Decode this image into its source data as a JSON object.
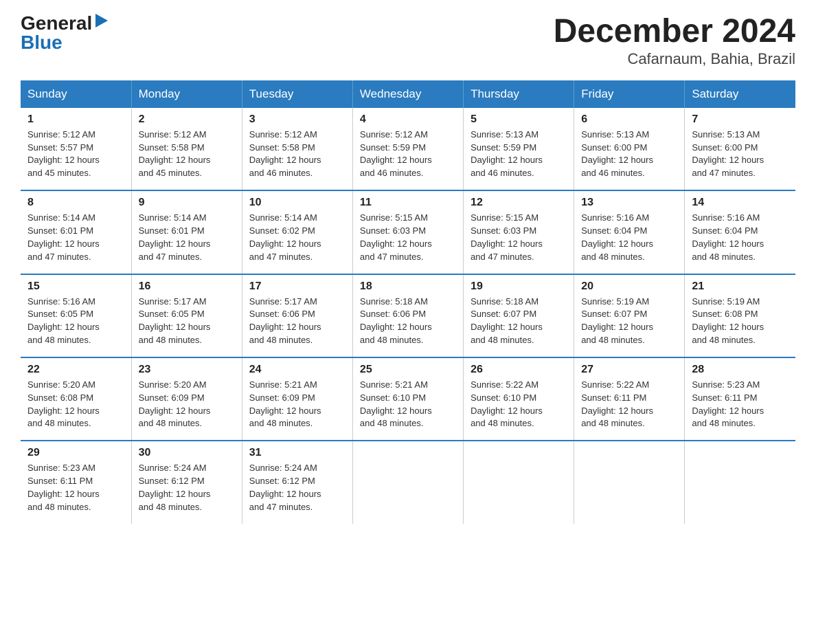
{
  "logo": {
    "general": "General",
    "blue": "Blue"
  },
  "title": "December 2024",
  "subtitle": "Cafarnaum, Bahia, Brazil",
  "days_of_week": [
    "Sunday",
    "Monday",
    "Tuesday",
    "Wednesday",
    "Thursday",
    "Friday",
    "Saturday"
  ],
  "weeks": [
    [
      {
        "day": "1",
        "sunrise": "5:12 AM",
        "sunset": "5:57 PM",
        "daylight": "12 hours and 45 minutes."
      },
      {
        "day": "2",
        "sunrise": "5:12 AM",
        "sunset": "5:58 PM",
        "daylight": "12 hours and 45 minutes."
      },
      {
        "day": "3",
        "sunrise": "5:12 AM",
        "sunset": "5:58 PM",
        "daylight": "12 hours and 46 minutes."
      },
      {
        "day": "4",
        "sunrise": "5:12 AM",
        "sunset": "5:59 PM",
        "daylight": "12 hours and 46 minutes."
      },
      {
        "day": "5",
        "sunrise": "5:13 AM",
        "sunset": "5:59 PM",
        "daylight": "12 hours and 46 minutes."
      },
      {
        "day": "6",
        "sunrise": "5:13 AM",
        "sunset": "6:00 PM",
        "daylight": "12 hours and 46 minutes."
      },
      {
        "day": "7",
        "sunrise": "5:13 AM",
        "sunset": "6:00 PM",
        "daylight": "12 hours and 47 minutes."
      }
    ],
    [
      {
        "day": "8",
        "sunrise": "5:14 AM",
        "sunset": "6:01 PM",
        "daylight": "12 hours and 47 minutes."
      },
      {
        "day": "9",
        "sunrise": "5:14 AM",
        "sunset": "6:01 PM",
        "daylight": "12 hours and 47 minutes."
      },
      {
        "day": "10",
        "sunrise": "5:14 AM",
        "sunset": "6:02 PM",
        "daylight": "12 hours and 47 minutes."
      },
      {
        "day": "11",
        "sunrise": "5:15 AM",
        "sunset": "6:03 PM",
        "daylight": "12 hours and 47 minutes."
      },
      {
        "day": "12",
        "sunrise": "5:15 AM",
        "sunset": "6:03 PM",
        "daylight": "12 hours and 47 minutes."
      },
      {
        "day": "13",
        "sunrise": "5:16 AM",
        "sunset": "6:04 PM",
        "daylight": "12 hours and 48 minutes."
      },
      {
        "day": "14",
        "sunrise": "5:16 AM",
        "sunset": "6:04 PM",
        "daylight": "12 hours and 48 minutes."
      }
    ],
    [
      {
        "day": "15",
        "sunrise": "5:16 AM",
        "sunset": "6:05 PM",
        "daylight": "12 hours and 48 minutes."
      },
      {
        "day": "16",
        "sunrise": "5:17 AM",
        "sunset": "6:05 PM",
        "daylight": "12 hours and 48 minutes."
      },
      {
        "day": "17",
        "sunrise": "5:17 AM",
        "sunset": "6:06 PM",
        "daylight": "12 hours and 48 minutes."
      },
      {
        "day": "18",
        "sunrise": "5:18 AM",
        "sunset": "6:06 PM",
        "daylight": "12 hours and 48 minutes."
      },
      {
        "day": "19",
        "sunrise": "5:18 AM",
        "sunset": "6:07 PM",
        "daylight": "12 hours and 48 minutes."
      },
      {
        "day": "20",
        "sunrise": "5:19 AM",
        "sunset": "6:07 PM",
        "daylight": "12 hours and 48 minutes."
      },
      {
        "day": "21",
        "sunrise": "5:19 AM",
        "sunset": "6:08 PM",
        "daylight": "12 hours and 48 minutes."
      }
    ],
    [
      {
        "day": "22",
        "sunrise": "5:20 AM",
        "sunset": "6:08 PM",
        "daylight": "12 hours and 48 minutes."
      },
      {
        "day": "23",
        "sunrise": "5:20 AM",
        "sunset": "6:09 PM",
        "daylight": "12 hours and 48 minutes."
      },
      {
        "day": "24",
        "sunrise": "5:21 AM",
        "sunset": "6:09 PM",
        "daylight": "12 hours and 48 minutes."
      },
      {
        "day": "25",
        "sunrise": "5:21 AM",
        "sunset": "6:10 PM",
        "daylight": "12 hours and 48 minutes."
      },
      {
        "day": "26",
        "sunrise": "5:22 AM",
        "sunset": "6:10 PM",
        "daylight": "12 hours and 48 minutes."
      },
      {
        "day": "27",
        "sunrise": "5:22 AM",
        "sunset": "6:11 PM",
        "daylight": "12 hours and 48 minutes."
      },
      {
        "day": "28",
        "sunrise": "5:23 AM",
        "sunset": "6:11 PM",
        "daylight": "12 hours and 48 minutes."
      }
    ],
    [
      {
        "day": "29",
        "sunrise": "5:23 AM",
        "sunset": "6:11 PM",
        "daylight": "12 hours and 48 minutes."
      },
      {
        "day": "30",
        "sunrise": "5:24 AM",
        "sunset": "6:12 PM",
        "daylight": "12 hours and 48 minutes."
      },
      {
        "day": "31",
        "sunrise": "5:24 AM",
        "sunset": "6:12 PM",
        "daylight": "12 hours and 47 minutes."
      },
      null,
      null,
      null,
      null
    ]
  ],
  "labels": {
    "sunrise": "Sunrise:",
    "sunset": "Sunset:",
    "daylight": "Daylight:"
  }
}
